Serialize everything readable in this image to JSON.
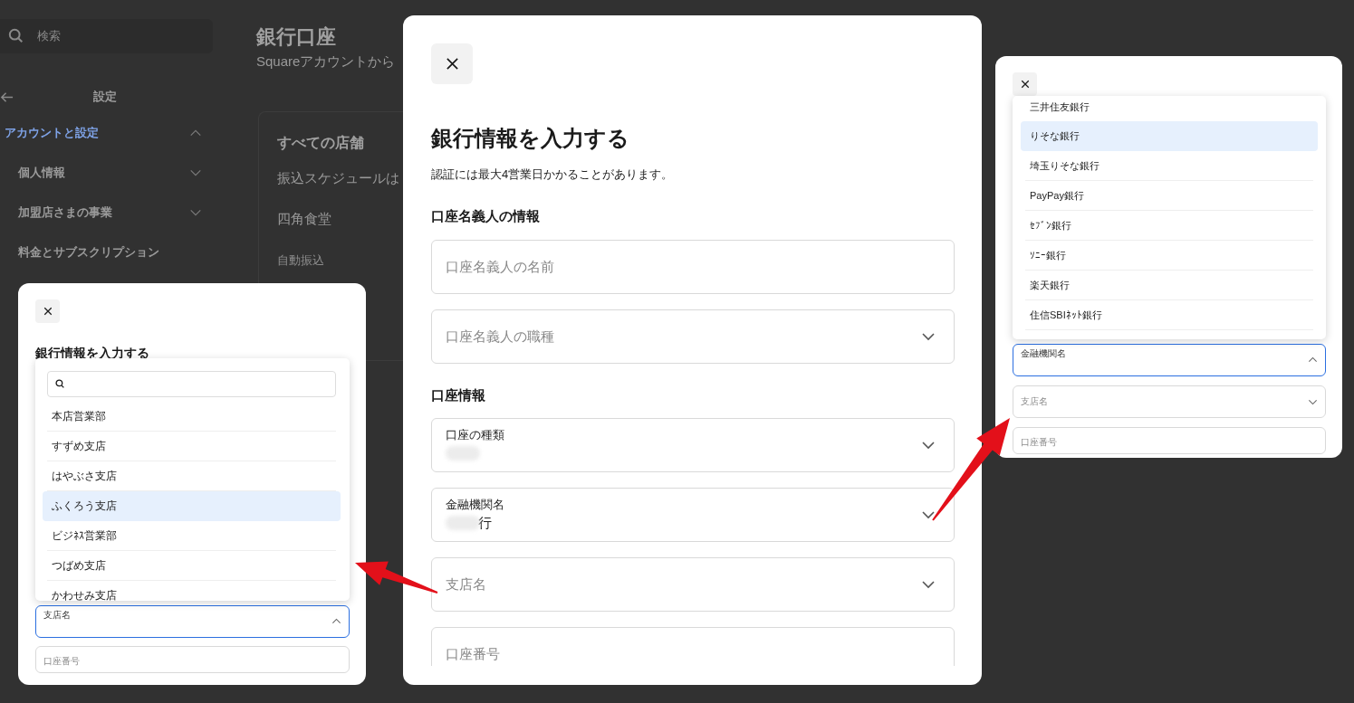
{
  "background": {
    "search": {
      "placeholder": "検索"
    },
    "sidebar": {
      "title": "設定",
      "items": [
        {
          "label": "アカウントと設定",
          "kind": "section",
          "expanded": true,
          "selected": true
        },
        {
          "label": "個人情報",
          "kind": "section",
          "expanded": false,
          "selected": false
        },
        {
          "label": "加盟店さまの事業",
          "kind": "section",
          "expanded": false,
          "selected": false
        },
        {
          "label": "料金とサブスクリプション",
          "kind": "link",
          "selected": false
        }
      ]
    },
    "page": {
      "title": "銀行口座",
      "subtitle": "Squareアカウントから",
      "card": {
        "title": "すべての店舗",
        "text": "振込スケジュールは",
        "location": "四角食堂",
        "label": "自動振込"
      }
    }
  },
  "modal_main": {
    "title": "銀行情報を入力する",
    "note": "認証には最大4営業日かかることがあります。",
    "sections": [
      {
        "heading": "口座名義人の情報",
        "fields": [
          {
            "kind": "text",
            "placeholder": "口座名義人の名前"
          },
          {
            "kind": "select",
            "placeholder": "口座名義人の職種",
            "expanded": false
          }
        ]
      },
      {
        "heading": "口座情報",
        "fields": [
          {
            "kind": "select",
            "label": "口座の種類",
            "redacted": true,
            "expanded": false
          },
          {
            "kind": "select",
            "label": "金融機関名",
            "redacted": true,
            "value": "行",
            "expanded": false
          },
          {
            "kind": "select",
            "placeholder": "支店名",
            "expanded": false
          },
          {
            "kind": "text",
            "placeholder": "口座番号"
          }
        ]
      }
    ]
  },
  "modal_branch": {
    "title": "銀行情報を入力する",
    "options": [
      {
        "label": "本店営業部",
        "selected": false
      },
      {
        "label": "すずめ支店",
        "selected": false
      },
      {
        "label": "はやぶさ支店",
        "selected": false
      },
      {
        "label": "ふくろう支店",
        "selected": true
      },
      {
        "label": "ビジﾈｽ営業部",
        "selected": false
      },
      {
        "label": "つばめ支店",
        "selected": false
      },
      {
        "label": "かわせみ支店",
        "selected": false
      }
    ],
    "fields": [
      {
        "kind": "select",
        "label": "支店名",
        "expanded": true
      },
      {
        "kind": "text",
        "placeholder": "口座番号"
      }
    ]
  },
  "modal_bank": {
    "options": [
      {
        "label": "三井住友銀行",
        "selected": false
      },
      {
        "label": "りそな銀行",
        "selected": true
      },
      {
        "label": "埼玉りそな銀行",
        "selected": false
      },
      {
        "label": "PayPay銀行",
        "selected": false
      },
      {
        "label": "ｾﾌﾞﾝ銀行",
        "selected": false
      },
      {
        "label": "ｿﾆｰ銀行",
        "selected": false
      },
      {
        "label": "楽天銀行",
        "selected": false
      },
      {
        "label": "住信SBIﾈｯﾄ銀行",
        "selected": false
      }
    ],
    "fields": [
      {
        "kind": "select",
        "label": "金融機関名",
        "expanded": true
      },
      {
        "kind": "select",
        "placeholder": "支店名",
        "expanded": false
      },
      {
        "kind": "text",
        "placeholder": "口座番号"
      }
    ]
  }
}
